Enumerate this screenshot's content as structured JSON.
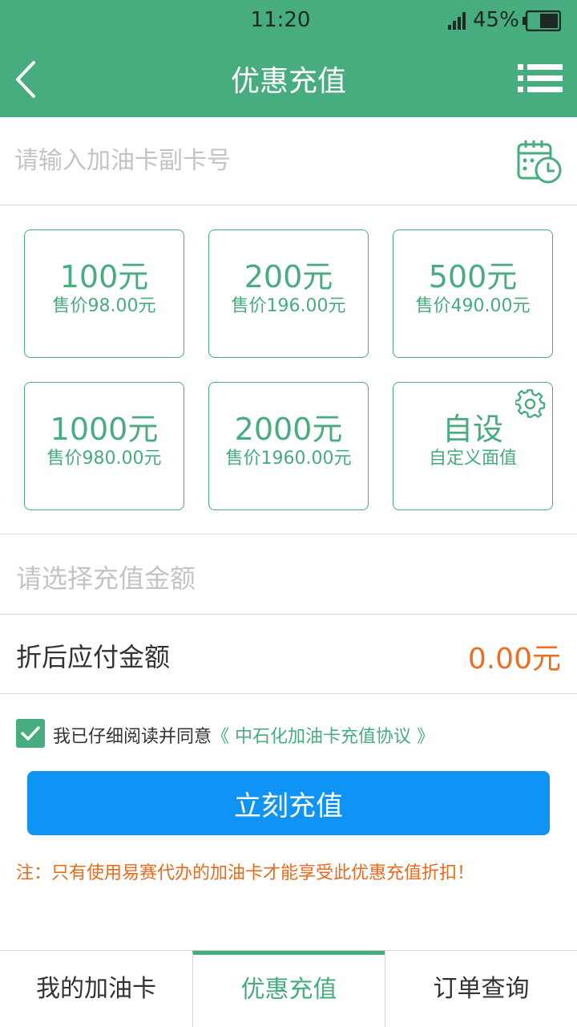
{
  "status_bar": {
    "time": "11:20",
    "battery": "45%"
  },
  "header": {
    "title": "优惠充值",
    "back_icon": "back-chevron-icon",
    "menu_icon": "list-menu-icon"
  },
  "card_input": {
    "placeholder": "请输入加油卡副卡号",
    "history_icon": "calendar-clock-icon"
  },
  "amount_options": [
    {
      "amount": "100元",
      "price": "售价98.00元"
    },
    {
      "amount": "200元",
      "price": "售价196.00元"
    },
    {
      "amount": "500元",
      "price": "售价490.00元"
    },
    {
      "amount": "1000元",
      "price": "售价980.00元"
    },
    {
      "amount": "2000元",
      "price": "售价1960.00元"
    },
    {
      "amount": "自设",
      "price": "自定义面值",
      "icon": "gear-icon"
    }
  ],
  "select_amount": {
    "placeholder": "请选择充值金额"
  },
  "payable": {
    "label": "折后应付金额",
    "value": "0.00元"
  },
  "agreement": {
    "checked": true,
    "text": "我已仔细阅读并同意",
    "link": "《 中石化加油卡充值协议 》"
  },
  "submit": {
    "label": "立刻充值"
  },
  "note": "注：只有使用易赛代办的加油卡才能享受此优惠充值折扣！",
  "tabs": [
    {
      "label": "我的加油卡",
      "active": false
    },
    {
      "label": "优惠充值",
      "active": true
    },
    {
      "label": "订单查询",
      "active": false
    }
  ],
  "colors": {
    "primary": "#47ac7e",
    "button": "#0f94f5",
    "accent": "#ea7020"
  }
}
